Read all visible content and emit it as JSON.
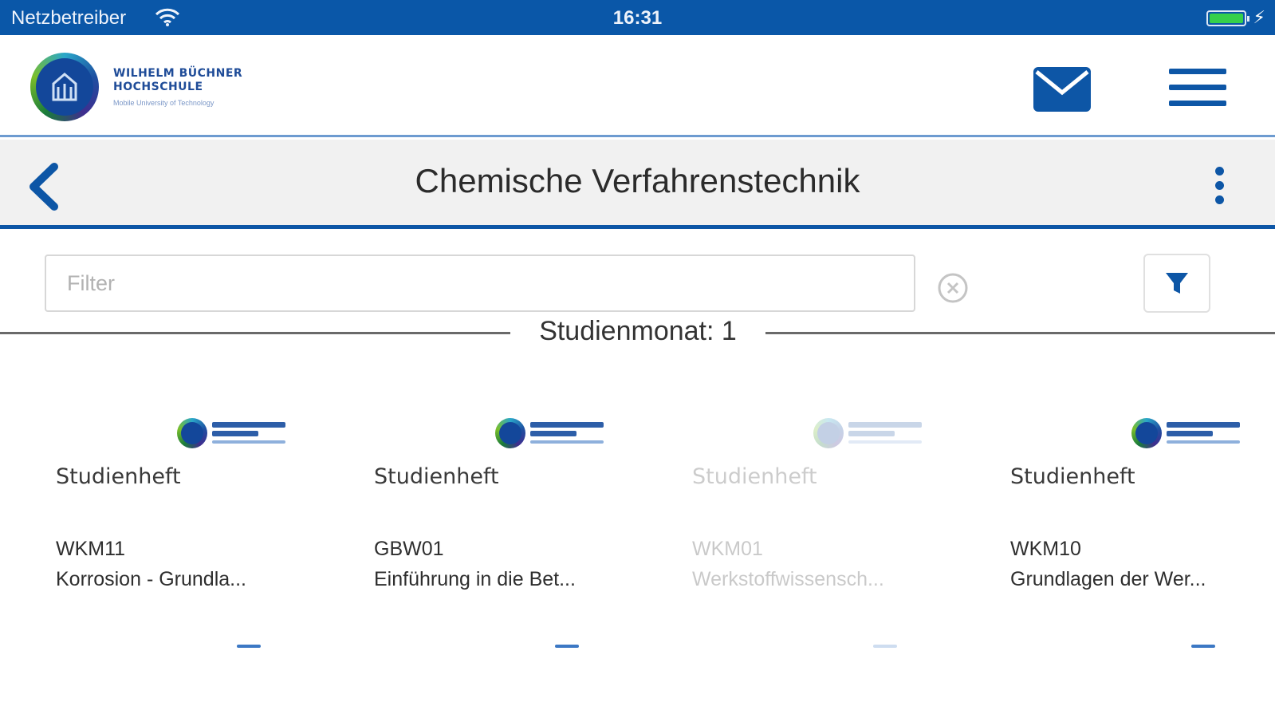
{
  "status_bar": {
    "carrier": "Netzbetreiber",
    "time": "16:31",
    "battery_level": 1.0
  },
  "header": {
    "logo_line1": "WILHELM BÜCHNER",
    "logo_line2": "HOCHSCHULE",
    "logo_tagline": "Mobile University of Technology",
    "mail_icon": "mail-icon",
    "menu_icon": "hamburger-menu-icon"
  },
  "title_bar": {
    "back_icon": "chevron-left-icon",
    "title": "Chemische Verfahrenstechnik",
    "more_icon": "vertical-ellipsis-icon"
  },
  "filter": {
    "value": "",
    "placeholder": "Filter",
    "clear_icon": "clear-circle-icon",
    "filter_icon": "funnel-icon"
  },
  "section": {
    "label": "Studienmonat: 1"
  },
  "cards": [
    {
      "type": "Studienheft",
      "code": "WKM11",
      "name": "Korrosion - Grundla...",
      "enabled": true
    },
    {
      "type": "Studienheft",
      "code": "GBW01",
      "name": "Einführung in die Bet...",
      "enabled": true
    },
    {
      "type": "Studienheft",
      "code": "WKM01",
      "name": "Werkstoffwissensch...",
      "enabled": false
    },
    {
      "type": "Studienheft",
      "code": "WKM10",
      "name": "Grundlagen der Wer...",
      "enabled": true
    }
  ],
  "colors": {
    "brand_blue": "#0d56a6",
    "status_bar": "#0a57a8",
    "title_bar_bg": "#f1f1f1",
    "battery_green": "#35d04a"
  }
}
